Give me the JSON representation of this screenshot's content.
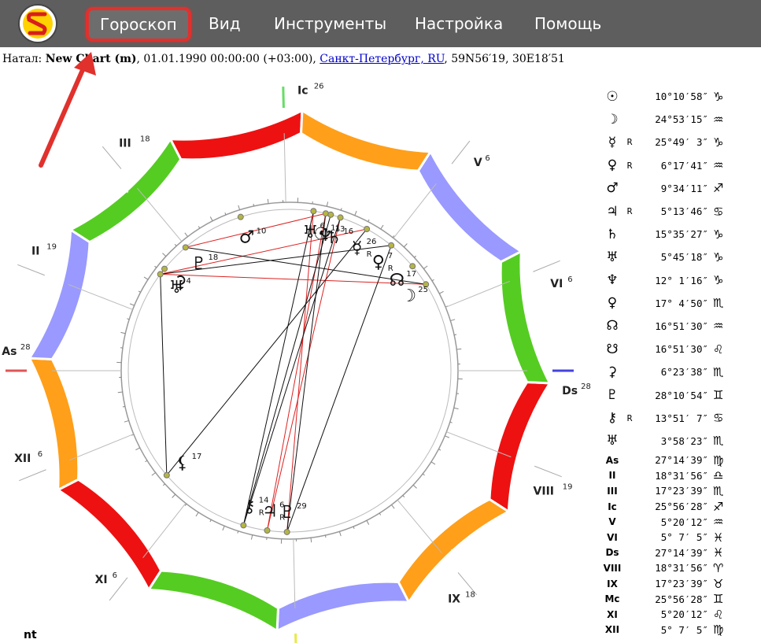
{
  "menu": {
    "items": [
      "Гороскоп",
      "Вид",
      "Инструменты",
      "Настройка",
      "Помощь"
    ],
    "active_index": 0
  },
  "info": {
    "prefix": "Натал:",
    "name": "New Chart (m)",
    "datetime": ", 01.01.1990 00:00:00 (+03:00), ",
    "place": "Санкт-Петербург, RU",
    "coords": ", 59N56′19, 30E18′51"
  },
  "bottom_text": "nt",
  "colors": {
    "fire": "#ee1111",
    "earth": "#ff9f1a",
    "air": "#9999ff",
    "water": "#55cc22",
    "highlight": "#e0312d"
  },
  "chart": {
    "ascendant_lon": 177.24,
    "signs": [
      {
        "name": "aries",
        "glyph": "♈",
        "element": "fire"
      },
      {
        "name": "taurus",
        "glyph": "♉",
        "element": "earth"
      },
      {
        "name": "gemini",
        "glyph": "♊",
        "element": "air"
      },
      {
        "name": "cancer",
        "glyph": "♋",
        "element": "water"
      },
      {
        "name": "leo",
        "glyph": "♌",
        "element": "fire"
      },
      {
        "name": "virgo",
        "glyph": "♍",
        "element": "earth"
      },
      {
        "name": "libra",
        "glyph": "♎",
        "element": "air"
      },
      {
        "name": "scorpio",
        "glyph": "♏",
        "element": "water"
      },
      {
        "name": "sagittarius",
        "glyph": "♐",
        "element": "fire"
      },
      {
        "name": "capricorn",
        "glyph": "♑",
        "element": "earth"
      },
      {
        "name": "aquarius",
        "glyph": "♒",
        "element": "air"
      },
      {
        "name": "pisces",
        "glyph": "♓",
        "element": "water"
      }
    ],
    "houses": [
      {
        "label": "As",
        "deg": "28",
        "lon": 177.24
      },
      {
        "label": "II",
        "deg": "19",
        "lon": 198.53
      },
      {
        "label": "III",
        "deg": "18",
        "lon": 227.39
      },
      {
        "label": "Ic",
        "deg": "26",
        "lon": 265.94
      },
      {
        "label": "V",
        "deg": "6",
        "lon": 305.34
      },
      {
        "label": "VI",
        "deg": "6",
        "lon": 335.12
      },
      {
        "label": "Ds",
        "deg": "28",
        "lon": 357.24
      },
      {
        "label": "VIII",
        "deg": "19",
        "lon": 18.53
      },
      {
        "label": "IX",
        "deg": "18",
        "lon": 47.39
      },
      {
        "label": "Mc",
        "deg": "26",
        "lon": 85.94
      },
      {
        "label": "XI",
        "deg": "6",
        "lon": 125.34
      },
      {
        "label": "XII",
        "deg": "6",
        "lon": 155.12
      }
    ],
    "planets": [
      {
        "glyph": "☉",
        "label": "11",
        "retro": false,
        "lon": 280.18
      },
      {
        "glyph": "☽",
        "label": "25",
        "retro": false,
        "lon": 324.89
      },
      {
        "glyph": "☿",
        "label": "26",
        "retro": true,
        "lon": 295.83
      },
      {
        "glyph": "♀",
        "label": "7",
        "retro": true,
        "lon": 306.29
      },
      {
        "glyph": "♂",
        "label": "10",
        "retro": false,
        "lon": 249.57
      },
      {
        "glyph": "♃",
        "label": "6",
        "retro": true,
        "lon": 95.23
      },
      {
        "glyph": "♄",
        "label": "16",
        "retro": false,
        "lon": 285.59
      },
      {
        "glyph": "♅",
        "label": "6",
        "retro": false,
        "lon": 275.76
      },
      {
        "glyph": "♆",
        "label": "13",
        "retro": false,
        "lon": 282.02
      },
      {
        "glyph": "♇",
        "label": "18",
        "retro": false,
        "lon": 227.08
      },
      {
        "glyph": "☊",
        "label": "17",
        "retro": false,
        "lon": 316.86
      },
      {
        "glyph": "⚸",
        "label": "17",
        "retro": false,
        "lon": 136.86
      },
      {
        "glyph": "⚳",
        "label": "",
        "retro": false,
        "lon": 216.39
      },
      {
        "glyph": "♇",
        "label": "29",
        "retro": false,
        "lon": 88.18
      },
      {
        "glyph": "⚷",
        "label": "14",
        "retro": true,
        "lon": 103.86
      },
      {
        "glyph": "♅",
        "label": "4",
        "retro": false,
        "lon": 213.97
      }
    ]
  },
  "planet_table": [
    {
      "glyph": "☉",
      "retro": "",
      "degree": "10°10′58″",
      "sign": "♑"
    },
    {
      "glyph": "☽",
      "retro": "",
      "degree": "24°53′15″",
      "sign": "♒"
    },
    {
      "glyph": "☿",
      "retro": "R",
      "degree": "25°49′ 3″",
      "sign": "♑"
    },
    {
      "glyph": "♀",
      "retro": "R",
      "degree": "6°17′41″",
      "sign": "♒"
    },
    {
      "glyph": "♂",
      "retro": "",
      "degree": "9°34′11″",
      "sign": "♐"
    },
    {
      "glyph": "♃",
      "retro": "R",
      "degree": "5°13′46″",
      "sign": "♋"
    },
    {
      "glyph": "♄",
      "retro": "",
      "degree": "15°35′27″",
      "sign": "♑"
    },
    {
      "glyph": "♅",
      "retro": "",
      "degree": "5°45′18″",
      "sign": "♑"
    },
    {
      "glyph": "♆",
      "retro": "",
      "degree": "12° 1′16″",
      "sign": "♑"
    },
    {
      "glyph": "♀",
      "retro": "",
      "degree": "17° 4′50″",
      "sign": "♏"
    },
    {
      "glyph": "☊",
      "retro": "",
      "degree": "16°51′30″",
      "sign": "♒"
    },
    {
      "glyph": "☋",
      "retro": "",
      "degree": "16°51′30″",
      "sign": "♌"
    },
    {
      "glyph": "⚳",
      "retro": "",
      "degree": "6°23′38″",
      "sign": "♏"
    },
    {
      "glyph": "♇",
      "retro": "",
      "degree": "28°10′54″",
      "sign": "♊"
    },
    {
      "glyph": "⚷",
      "retro": "R",
      "degree": "13°51′ 7″",
      "sign": "♋"
    },
    {
      "glyph": "♅",
      "retro": "",
      "degree": "3°58′23″",
      "sign": "♏"
    }
  ],
  "house_table": [
    {
      "label": "As",
      "degree": "27°14′39″",
      "sign": "♍"
    },
    {
      "label": "II",
      "degree": "18°31′56″",
      "sign": "♎"
    },
    {
      "label": "III",
      "degree": "17°23′39″",
      "sign": "♏"
    },
    {
      "label": "Ic",
      "degree": "25°56′28″",
      "sign": "♐"
    },
    {
      "label": "V",
      "degree": "5°20′12″",
      "sign": "♒"
    },
    {
      "label": "VI",
      "degree": "5° 7′ 5″",
      "sign": "♓"
    },
    {
      "label": "Ds",
      "degree": "27°14′39″",
      "sign": "♓"
    },
    {
      "label": "VIII",
      "degree": "18°31′56″",
      "sign": "♈"
    },
    {
      "label": "IX",
      "degree": "17°23′39″",
      "sign": "♉"
    },
    {
      "label": "Mc",
      "degree": "25°56′28″",
      "sign": "♊"
    },
    {
      "label": "XI",
      "degree": "5°20′12″",
      "sign": "♌"
    },
    {
      "label": "XII",
      "degree": "5° 7′ 5″",
      "sign": "♍"
    }
  ]
}
